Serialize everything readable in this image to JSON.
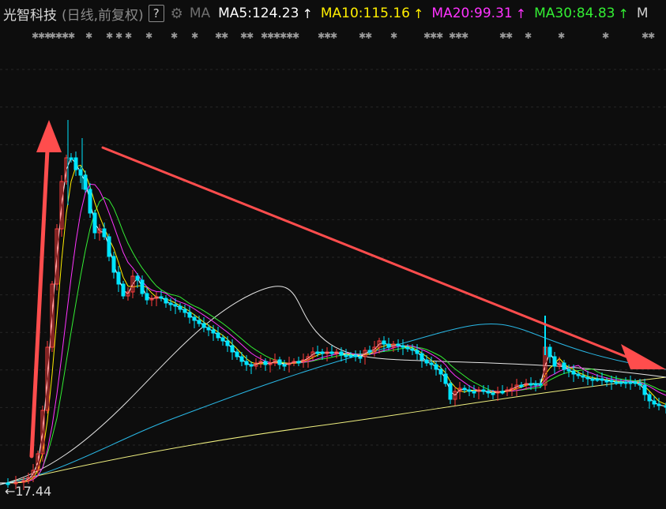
{
  "header": {
    "stock_name": "光智科技",
    "period_label": "(日线,前复权)",
    "help": "?",
    "ma_toggle": "MA",
    "indicators": [
      {
        "label": "MA5:124.23",
        "color": "#ffffff",
        "arrow": "↑"
      },
      {
        "label": "MA10:115.16",
        "color": "#ffee00",
        "arrow": "↑"
      },
      {
        "label": "MA20:99.31",
        "color": "#ff33ff",
        "arrow": "↑"
      },
      {
        "label": "MA30:84.83",
        "color": "#33ee33",
        "arrow": "↑"
      },
      {
        "label": "M",
        "color": "#cfcfcf",
        "arrow": ""
      }
    ],
    "gear_icon": "gear-icon"
  },
  "low_label": "17.44",
  "chart_data": {
    "type": "candlestick",
    "low_price": 17.44,
    "colors": {
      "up": "#ff3b3b",
      "down": "#00e5ff",
      "ma5": "#ffffff",
      "ma10": "#ffee00",
      "ma20": "#ff33ff",
      "ma30": "#33ee33",
      "ma60": "#e6e6e6",
      "ma120": "#29b8e6",
      "ma250": "#f0f080",
      "annotation": "#ff4d4d"
    },
    "annotations": [
      "up-arrow",
      "down-trend-arrow"
    ]
  }
}
